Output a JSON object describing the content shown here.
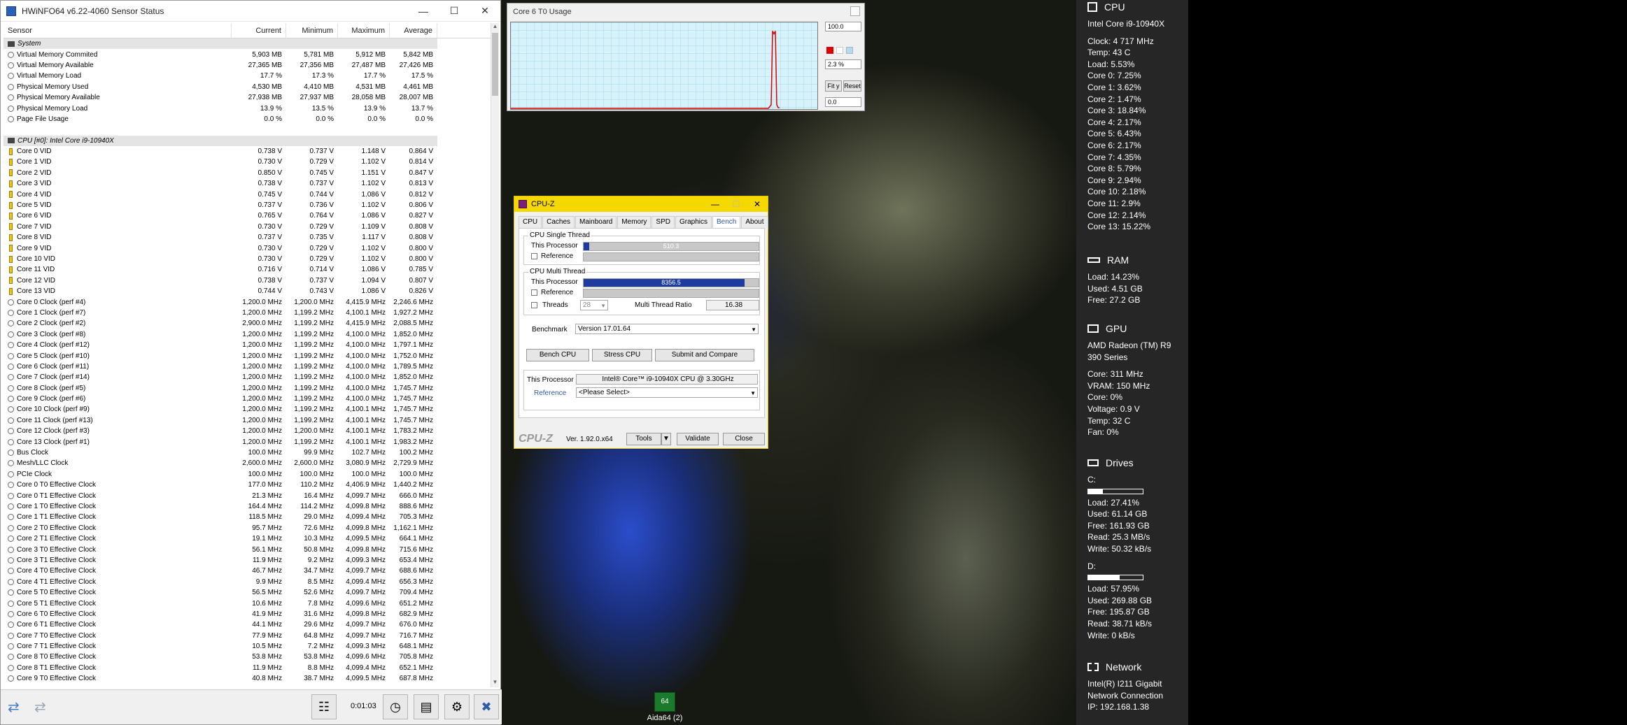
{
  "hwinfo": {
    "title": "HWiNFO64 v6.22-4060 Sensor Status",
    "columns": [
      "Sensor",
      "Current",
      "Minimum",
      "Maximum",
      "Average"
    ],
    "rows": [
      {
        "type": "group",
        "name": "System"
      },
      {
        "icon": "circle",
        "name": "Virtual Memory Commited",
        "cur": "5,903 MB",
        "min": "5,781 MB",
        "max": "5,912 MB",
        "avg": "5,842 MB"
      },
      {
        "icon": "circle",
        "name": "Virtual Memory Available",
        "cur": "27,365 MB",
        "min": "27,356 MB",
        "max": "27,487 MB",
        "avg": "27,426 MB"
      },
      {
        "icon": "circle",
        "name": "Virtual Memory Load",
        "cur": "17.7 %",
        "min": "17.3 %",
        "max": "17.7 %",
        "avg": "17.5 %"
      },
      {
        "icon": "circle",
        "name": "Physical Memory Used",
        "cur": "4,530 MB",
        "min": "4,410 MB",
        "max": "4,531 MB",
        "avg": "4,461 MB"
      },
      {
        "icon": "circle",
        "name": "Physical Memory Available",
        "cur": "27,938 MB",
        "min": "27,937 MB",
        "max": "28,058 MB",
        "avg": "28,007 MB"
      },
      {
        "icon": "circle",
        "name": "Physical Memory Load",
        "cur": "13.9 %",
        "min": "13.5 %",
        "max": "13.9 %",
        "avg": "13.7 %"
      },
      {
        "icon": "circle",
        "name": "Page File Usage",
        "cur": "0.0 %",
        "min": "0.0 %",
        "max": "0.0 %",
        "avg": "0.0 %"
      },
      {
        "type": "blank"
      },
      {
        "type": "group",
        "name": "CPU [#0]: Intel Core i9-10940X"
      },
      {
        "icon": "volt",
        "name": "Core 0 VID",
        "cur": "0.738 V",
        "min": "0.737 V",
        "max": "1.148 V",
        "avg": "0.864 V"
      },
      {
        "icon": "volt",
        "name": "Core 1 VID",
        "cur": "0.730 V",
        "min": "0.729 V",
        "max": "1.102 V",
        "avg": "0.814 V"
      },
      {
        "icon": "volt",
        "name": "Core 2 VID",
        "cur": "0.850 V",
        "min": "0.745 V",
        "max": "1.151 V",
        "avg": "0.847 V"
      },
      {
        "icon": "volt",
        "name": "Core 3 VID",
        "cur": "0.738 V",
        "min": "0.737 V",
        "max": "1.102 V",
        "avg": "0.813 V"
      },
      {
        "icon": "volt",
        "name": "Core 4 VID",
        "cur": "0.745 V",
        "min": "0.744 V",
        "max": "1.086 V",
        "avg": "0.812 V"
      },
      {
        "icon": "volt",
        "name": "Core 5 VID",
        "cur": "0.737 V",
        "min": "0.736 V",
        "max": "1.102 V",
        "avg": "0.806 V"
      },
      {
        "icon": "volt",
        "name": "Core 6 VID",
        "cur": "0.765 V",
        "min": "0.764 V",
        "max": "1.086 V",
        "avg": "0.827 V"
      },
      {
        "icon": "volt",
        "name": "Core 7 VID",
        "cur": "0.730 V",
        "min": "0.729 V",
        "max": "1.109 V",
        "avg": "0.808 V"
      },
      {
        "icon": "volt",
        "name": "Core 8 VID",
        "cur": "0.737 V",
        "min": "0.735 V",
        "max": "1.117 V",
        "avg": "0.808 V"
      },
      {
        "icon": "volt",
        "name": "Core 9 VID",
        "cur": "0.730 V",
        "min": "0.729 V",
        "max": "1.102 V",
        "avg": "0.800 V"
      },
      {
        "icon": "volt",
        "name": "Core 10 VID",
        "cur": "0.730 V",
        "min": "0.729 V",
        "max": "1.102 V",
        "avg": "0.800 V"
      },
      {
        "icon": "volt",
        "name": "Core 11 VID",
        "cur": "0.716 V",
        "min": "0.714 V",
        "max": "1.086 V",
        "avg": "0.785 V"
      },
      {
        "icon": "volt",
        "name": "Core 12 VID",
        "cur": "0.738 V",
        "min": "0.737 V",
        "max": "1.094 V",
        "avg": "0.807 V"
      },
      {
        "icon": "volt",
        "name": "Core 13 VID",
        "cur": "0.744 V",
        "min": "0.743 V",
        "max": "1.086 V",
        "avg": "0.826 V"
      },
      {
        "icon": "circle",
        "name": "Core 0 Clock (perf #4)",
        "cur": "1,200.0 MHz",
        "min": "1,200.0 MHz",
        "max": "4,415.9 MHz",
        "avg": "2,246.6 MHz"
      },
      {
        "icon": "circle",
        "name": "Core 1 Clock (perf #7)",
        "cur": "1,200.0 MHz",
        "min": "1,199.2 MHz",
        "max": "4,100.1 MHz",
        "avg": "1,927.2 MHz"
      },
      {
        "icon": "circle",
        "name": "Core 2 Clock (perf #2)",
        "cur": "2,900.0 MHz",
        "min": "1,199.2 MHz",
        "max": "4,415.9 MHz",
        "avg": "2,088.5 MHz"
      },
      {
        "icon": "circle",
        "name": "Core 3 Clock (perf #8)",
        "cur": "1,200.0 MHz",
        "min": "1,199.2 MHz",
        "max": "4,100.0 MHz",
        "avg": "1,852.0 MHz"
      },
      {
        "icon": "circle",
        "name": "Core 4 Clock (perf #12)",
        "cur": "1,200.0 MHz",
        "min": "1,199.2 MHz",
        "max": "4,100.0 MHz",
        "avg": "1,797.1 MHz"
      },
      {
        "icon": "circle",
        "name": "Core 5 Clock (perf #10)",
        "cur": "1,200.0 MHz",
        "min": "1,199.2 MHz",
        "max": "4,100.0 MHz",
        "avg": "1,752.0 MHz"
      },
      {
        "icon": "circle",
        "name": "Core 6 Clock (perf #11)",
        "cur": "1,200.0 MHz",
        "min": "1,199.2 MHz",
        "max": "4,100.0 MHz",
        "avg": "1,789.5 MHz"
      },
      {
        "icon": "circle",
        "name": "Core 7 Clock (perf #14)",
        "cur": "1,200.0 MHz",
        "min": "1,199.2 MHz",
        "max": "4,100.0 MHz",
        "avg": "1,852.0 MHz"
      },
      {
        "icon": "circle",
        "name": "Core 8 Clock (perf #5)",
        "cur": "1,200.0 MHz",
        "min": "1,199.2 MHz",
        "max": "4,100.0 MHz",
        "avg": "1,745.7 MHz"
      },
      {
        "icon": "circle",
        "name": "Core 9 Clock (perf #6)",
        "cur": "1,200.0 MHz",
        "min": "1,199.2 MHz",
        "max": "4,100.0 MHz",
        "avg": "1,745.7 MHz"
      },
      {
        "icon": "circle",
        "name": "Core 10 Clock (perf #9)",
        "cur": "1,200.0 MHz",
        "min": "1,199.2 MHz",
        "max": "4,100.1 MHz",
        "avg": "1,745.7 MHz"
      },
      {
        "icon": "circle",
        "name": "Core 11 Clock (perf #13)",
        "cur": "1,200.0 MHz",
        "min": "1,199.2 MHz",
        "max": "4,100.1 MHz",
        "avg": "1,745.7 MHz"
      },
      {
        "icon": "circle",
        "name": "Core 12 Clock (perf #3)",
        "cur": "1,200.0 MHz",
        "min": "1,200.0 MHz",
        "max": "4,100.1 MHz",
        "avg": "1,783.2 MHz"
      },
      {
        "icon": "circle",
        "name": "Core 13 Clock (perf #1)",
        "cur": "1,200.0 MHz",
        "min": "1,199.2 MHz",
        "max": "4,100.1 MHz",
        "avg": "1,983.2 MHz"
      },
      {
        "icon": "circle",
        "name": "Bus Clock",
        "cur": "100.0 MHz",
        "min": "99.9 MHz",
        "max": "102.7 MHz",
        "avg": "100.2 MHz"
      },
      {
        "icon": "circle",
        "name": "Mesh/LLC Clock",
        "cur": "2,600.0 MHz",
        "min": "2,600.0 MHz",
        "max": "3,080.9 MHz",
        "avg": "2,729.9 MHz"
      },
      {
        "icon": "circle",
        "name": "PCIe Clock",
        "cur": "100.0 MHz",
        "min": "100.0 MHz",
        "max": "100.0 MHz",
        "avg": "100.0 MHz"
      },
      {
        "icon": "circle",
        "name": "Core 0 T0 Effective Clock",
        "cur": "177.0 MHz",
        "min": "110.2 MHz",
        "max": "4,406.9 MHz",
        "avg": "1,440.2 MHz"
      },
      {
        "icon": "circle",
        "name": "Core 0 T1 Effective Clock",
        "cur": "21.3 MHz",
        "min": "16.4 MHz",
        "max": "4,099.7 MHz",
        "avg": "666.0 MHz"
      },
      {
        "icon": "circle",
        "name": "Core 1 T0 Effective Clock",
        "cur": "164.4 MHz",
        "min": "114.2 MHz",
        "max": "4,099.8 MHz",
        "avg": "888.6 MHz"
      },
      {
        "icon": "circle",
        "name": "Core 1 T1 Effective Clock",
        "cur": "118.5 MHz",
        "min": "29.0 MHz",
        "max": "4,099.4 MHz",
        "avg": "705.3 MHz"
      },
      {
        "icon": "circle",
        "name": "Core 2 T0 Effective Clock",
        "cur": "95.7 MHz",
        "min": "72.6 MHz",
        "max": "4,099.8 MHz",
        "avg": "1,162.1 MHz"
      },
      {
        "icon": "circle",
        "name": "Core 2 T1 Effective Clock",
        "cur": "19.1 MHz",
        "min": "10.3 MHz",
        "max": "4,099.5 MHz",
        "avg": "664.1 MHz"
      },
      {
        "icon": "circle",
        "name": "Core 3 T0 Effective Clock",
        "cur": "56.1 MHz",
        "min": "50.8 MHz",
        "max": "4,099.8 MHz",
        "avg": "715.6 MHz"
      },
      {
        "icon": "circle",
        "name": "Core 3 T1 Effective Clock",
        "cur": "11.9 MHz",
        "min": "9.2 MHz",
        "max": "4,099.3 MHz",
        "avg": "653.4 MHz"
      },
      {
        "icon": "circle",
        "name": "Core 4 T0 Effective Clock",
        "cur": "46.7 MHz",
        "min": "34.7 MHz",
        "max": "4,099.7 MHz",
        "avg": "688.6 MHz"
      },
      {
        "icon": "circle",
        "name": "Core 4 T1 Effective Clock",
        "cur": "9.9 MHz",
        "min": "8.5 MHz",
        "max": "4,099.4 MHz",
        "avg": "656.3 MHz"
      },
      {
        "icon": "circle",
        "name": "Core 5 T0 Effective Clock",
        "cur": "56.5 MHz",
        "min": "52.6 MHz",
        "max": "4,099.7 MHz",
        "avg": "709.4 MHz"
      },
      {
        "icon": "circle",
        "name": "Core 5 T1 Effective Clock",
        "cur": "10.6 MHz",
        "min": "7.8 MHz",
        "max": "4,099.6 MHz",
        "avg": "651.2 MHz"
      },
      {
        "icon": "circle",
        "name": "Core 6 T0 Effective Clock",
        "cur": "41.9 MHz",
        "min": "31.6 MHz",
        "max": "4,099.8 MHz",
        "avg": "682.9 MHz"
      },
      {
        "icon": "circle",
        "name": "Core 6 T1 Effective Clock",
        "cur": "44.1 MHz",
        "min": "29.6 MHz",
        "max": "4,099.7 MHz",
        "avg": "676.0 MHz"
      },
      {
        "icon": "circle",
        "name": "Core 7 T0 Effective Clock",
        "cur": "77.9 MHz",
        "min": "64.8 MHz",
        "max": "4,099.7 MHz",
        "avg": "716.7 MHz"
      },
      {
        "icon": "circle",
        "name": "Core 7 T1 Effective Clock",
        "cur": "10.5 MHz",
        "min": "7.2 MHz",
        "max": "4,099.3 MHz",
        "avg": "648.1 MHz"
      },
      {
        "icon": "circle",
        "name": "Core 8 T0 Effective Clock",
        "cur": "53.8 MHz",
        "min": "53.8 MHz",
        "max": "4,099.6 MHz",
        "avg": "705.8 MHz"
      },
      {
        "icon": "circle",
        "name": "Core 8 T1 Effective Clock",
        "cur": "11.9 MHz",
        "min": "8.8 MHz",
        "max": "4,099.4 MHz",
        "avg": "652.1 MHz"
      },
      {
        "icon": "circle",
        "name": "Core 9 T0 Effective Clock",
        "cur": "40.8 MHz",
        "min": "38.7 MHz",
        "max": "4,099.5 MHz",
        "avg": "687.8 MHz"
      }
    ],
    "status": {
      "elapsed": "0:01:03"
    }
  },
  "graph": {
    "title": "Core 6 T0 Usage",
    "max_value": "100.0",
    "current_value": "2.3 %",
    "min_value": "0.0",
    "fit_label": "Fit y",
    "reset_label": "Reset",
    "spike_percent": 0.9
  },
  "cpuz": {
    "title": "CPU-Z",
    "tabs": [
      "CPU",
      "Caches",
      "Mainboard",
      "Memory",
      "SPD",
      "Graphics",
      "Bench",
      "About"
    ],
    "active_tab": "Bench",
    "single_thread": {
      "label": "CPU Single Thread",
      "this_label": "This Processor",
      "value": "510.3",
      "fill": 0.03,
      "ref_label": "Reference"
    },
    "multi_thread": {
      "label": "CPU Multi Thread",
      "this_label": "This Processor",
      "value": "8356.5",
      "fill": 0.92,
      "ref_label": "Reference"
    },
    "threads_label": "Threads",
    "threads_value": "28",
    "ratio_label": "Multi Thread Ratio",
    "ratio_value": "16.38",
    "benchmark_label": "Benchmark",
    "benchmark_value": "Version 17.01.64",
    "bench_cpu": "Bench CPU",
    "stress_cpu": "Stress CPU",
    "submit": "Submit and Compare",
    "this_proc_label": "This Processor",
    "this_proc_value": "Intel® Core™ i9-10940X CPU @ 3.30GHz",
    "reference_label": "Reference",
    "reference_value": "<Please Select>",
    "logo": "CPU-Z",
    "version": "Ver. 1.92.0.x64",
    "tools": "Tools",
    "validate": "Validate",
    "close": "Close"
  },
  "desktop": {
    "icon_label": "Aida64 (2)"
  },
  "monitor": {
    "cpu": {
      "heading": "CPU",
      "name": "Intel Core i9-10940X",
      "lines": [
        "Clock: 4 717 MHz",
        "Temp: 43 C",
        "Load: 5.53%",
        "Core 0: 7.25%",
        "Core 1: 3.62%",
        "Core 2: 1.47%",
        "Core 3: 18.84%",
        "Core 4: 2.17%",
        "Core 5: 6.43%",
        "Core 6: 2.17%",
        "Core 7: 4.35%",
        "Core 8: 5.79%",
        "Core 9: 2.94%",
        "Core 10: 2.18%",
        "Core 11: 2.9%",
        "Core 12: 2.14%",
        "Core 13: 15.22%"
      ]
    },
    "ram": {
      "heading": "RAM",
      "lines": [
        "Load: 14.23%",
        "Used: 4.51 GB",
        "Free: 27.2 GB"
      ]
    },
    "gpu": {
      "heading": "GPU",
      "name_lines": [
        "AMD Radeon (TM) R9",
        "390 Series"
      ],
      "lines": [
        "Core: 311 MHz",
        "VRAM: 150 MHz",
        "Core: 0%",
        "Voltage: 0.9 V",
        "Temp: 32 C",
        "Fan: 0%"
      ]
    },
    "drives": {
      "heading": "Drives",
      "c": {
        "label": "C:",
        "load_fraction": 0.2741,
        "lines": [
          "Load: 27.41%",
          "Used: 61.14 GB",
          "Free: 161.93 GB",
          "Read: 25.3 MB/s",
          "Write: 50.32 kB/s"
        ]
      },
      "d": {
        "label": "D:",
        "load_fraction": 0.5795,
        "lines": [
          "Load: 57.95%",
          "Used: 269.88 GB",
          "Free: 195.87 GB",
          "Read: 38.71 kB/s",
          "Write: 0 kB/s"
        ]
      }
    },
    "network": {
      "heading": "Network",
      "lines": [
        "Intel(R) I211 Gigabit",
        "Network Connection",
        "IP: 192.168.1.38"
      ]
    }
  }
}
